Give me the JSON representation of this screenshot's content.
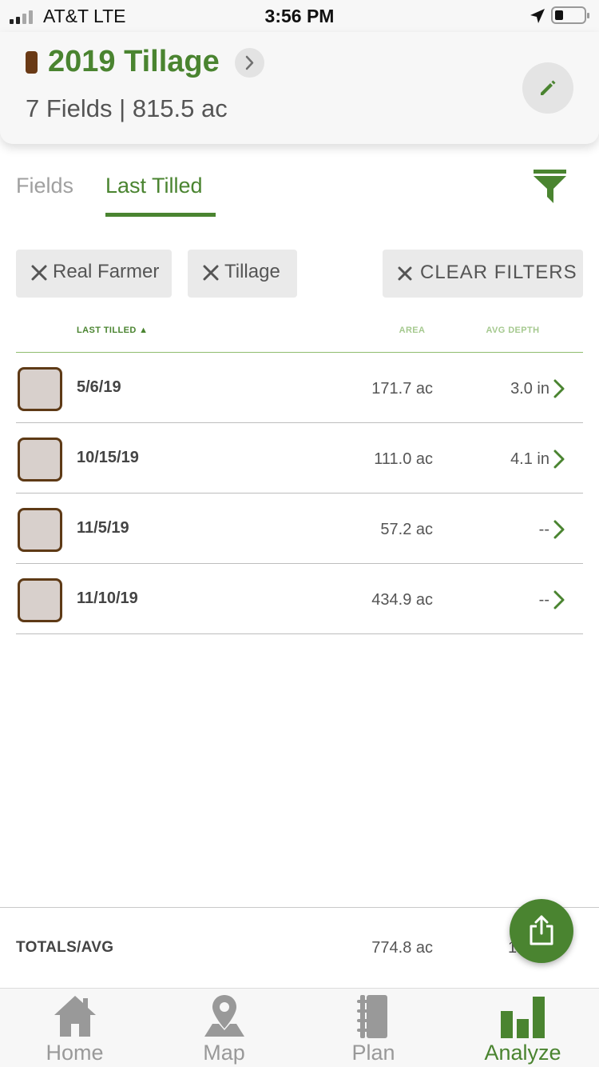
{
  "status_bar": {
    "carrier": "AT&T  LTE",
    "time": "3:56 PM"
  },
  "header": {
    "title": "2019 Tillage",
    "summary": "7 Fields | 815.5 ac",
    "swatch_color": "#6a3a16"
  },
  "tabs": [
    {
      "label": "Fields",
      "active": false
    },
    {
      "label": "Last Tilled",
      "active": true
    }
  ],
  "filters": {
    "chips": [
      "Real Farmer",
      "Tillage"
    ],
    "clear_label": "CLEAR FILTERS"
  },
  "table": {
    "columns": {
      "last_tilled": "LAST TILLED ▲",
      "area": "AREA",
      "avg_depth": "AVG DEPTH"
    },
    "rows": [
      {
        "date": "5/6/19",
        "area": "171.7 ac",
        "depth": "3.0 in"
      },
      {
        "date": "10/15/19",
        "area": "111.0 ac",
        "depth": "4.1 in"
      },
      {
        "date": "11/5/19",
        "area": "57.2 ac",
        "depth": "--"
      },
      {
        "date": "11/10/19",
        "area": "434.9 ac",
        "depth": "--"
      }
    ],
    "totals": {
      "label": "TOTALS/AVG",
      "area": "774.8 ac",
      "depth": "1"
    }
  },
  "nav": [
    {
      "label": "Home",
      "icon": "home-icon",
      "active": false
    },
    {
      "label": "Map",
      "icon": "map-pin-icon",
      "active": false
    },
    {
      "label": "Plan",
      "icon": "notebook-icon",
      "active": false
    },
    {
      "label": "Analyze",
      "icon": "bar-chart-icon",
      "active": true
    }
  ],
  "colors": {
    "accent": "#4a8430",
    "muted": "#999999"
  }
}
